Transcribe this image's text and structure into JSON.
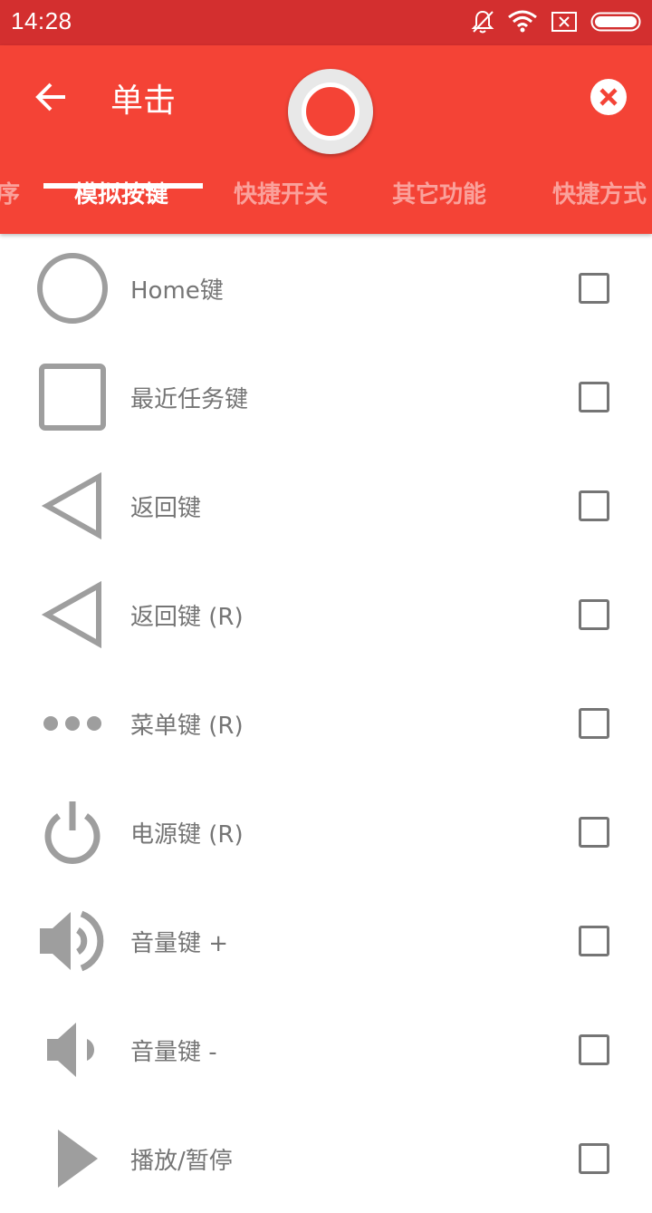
{
  "status_bar": {
    "time": "14:28",
    "icons": [
      "bell-off-icon",
      "wifi-icon",
      "sim-x-icon",
      "battery-icon"
    ]
  },
  "app_bar": {
    "title": "单击",
    "color": "#f44336",
    "back_icon": "arrow-back-icon",
    "close_icon": "close-circle-icon"
  },
  "tabs": [
    {
      "label": "程序",
      "active": false
    },
    {
      "label": "模拟按键",
      "active": true
    },
    {
      "label": "快捷开关",
      "active": false
    },
    {
      "label": "其它功能",
      "active": false
    },
    {
      "label": "快捷方式",
      "active": false
    }
  ],
  "list": {
    "items": [
      {
        "label": "Home键",
        "icon": "circle-home-icon",
        "checked": false
      },
      {
        "label": "最近任务键",
        "icon": "square-recents-icon",
        "checked": false
      },
      {
        "label": "返回键",
        "icon": "triangle-back-icon",
        "checked": false
      },
      {
        "label": "返回键 (R)",
        "icon": "triangle-back-icon",
        "checked": false
      },
      {
        "label": "菜单键 (R)",
        "icon": "dots-menu-icon",
        "checked": false
      },
      {
        "label": "电源键 (R)",
        "icon": "power-icon",
        "checked": false
      },
      {
        "label": "音量键 +",
        "icon": "volume-up-icon",
        "checked": false
      },
      {
        "label": "音量键 -",
        "icon": "volume-down-icon",
        "checked": false
      },
      {
        "label": "播放/暂停",
        "icon": "play-icon",
        "checked": false
      }
    ]
  }
}
